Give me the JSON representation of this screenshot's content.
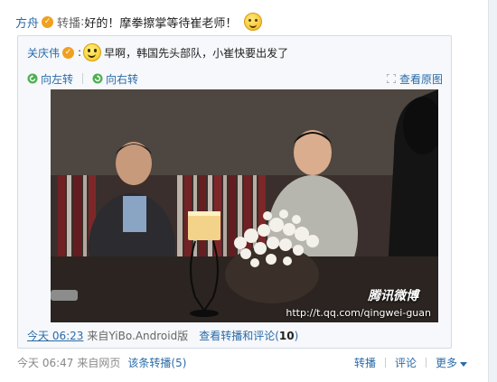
{
  "post": {
    "author": "方舟",
    "forward_label": "转播",
    "text": "好的！摩拳擦掌等待崔老师！"
  },
  "original": {
    "author": "关庆伟",
    "text": "早啊，韩国先头部队，小崔快要出发了"
  },
  "image_tools": {
    "rotate_left": "向左转",
    "rotate_right": "向右转",
    "view_original": "查看原图"
  },
  "photo": {
    "watermark_logo": "腾讯微博",
    "watermark_url": "http://t.qq.com/qingwei-guan"
  },
  "original_meta": {
    "time": "今天 06:23",
    "source": "来自YiBo.Android版",
    "view_link": "查看转播和评论",
    "count_open": "(",
    "count": "10",
    "count_close": ")"
  },
  "footer": {
    "time": "今天 06:47",
    "source": "来自网页",
    "thread_link": "该条转播(5)",
    "action_forward": "转播",
    "action_comment": "评论",
    "action_more": "更多"
  },
  "colors": {
    "link": "#2a6ba8",
    "verify_badge": "#f0a020"
  }
}
